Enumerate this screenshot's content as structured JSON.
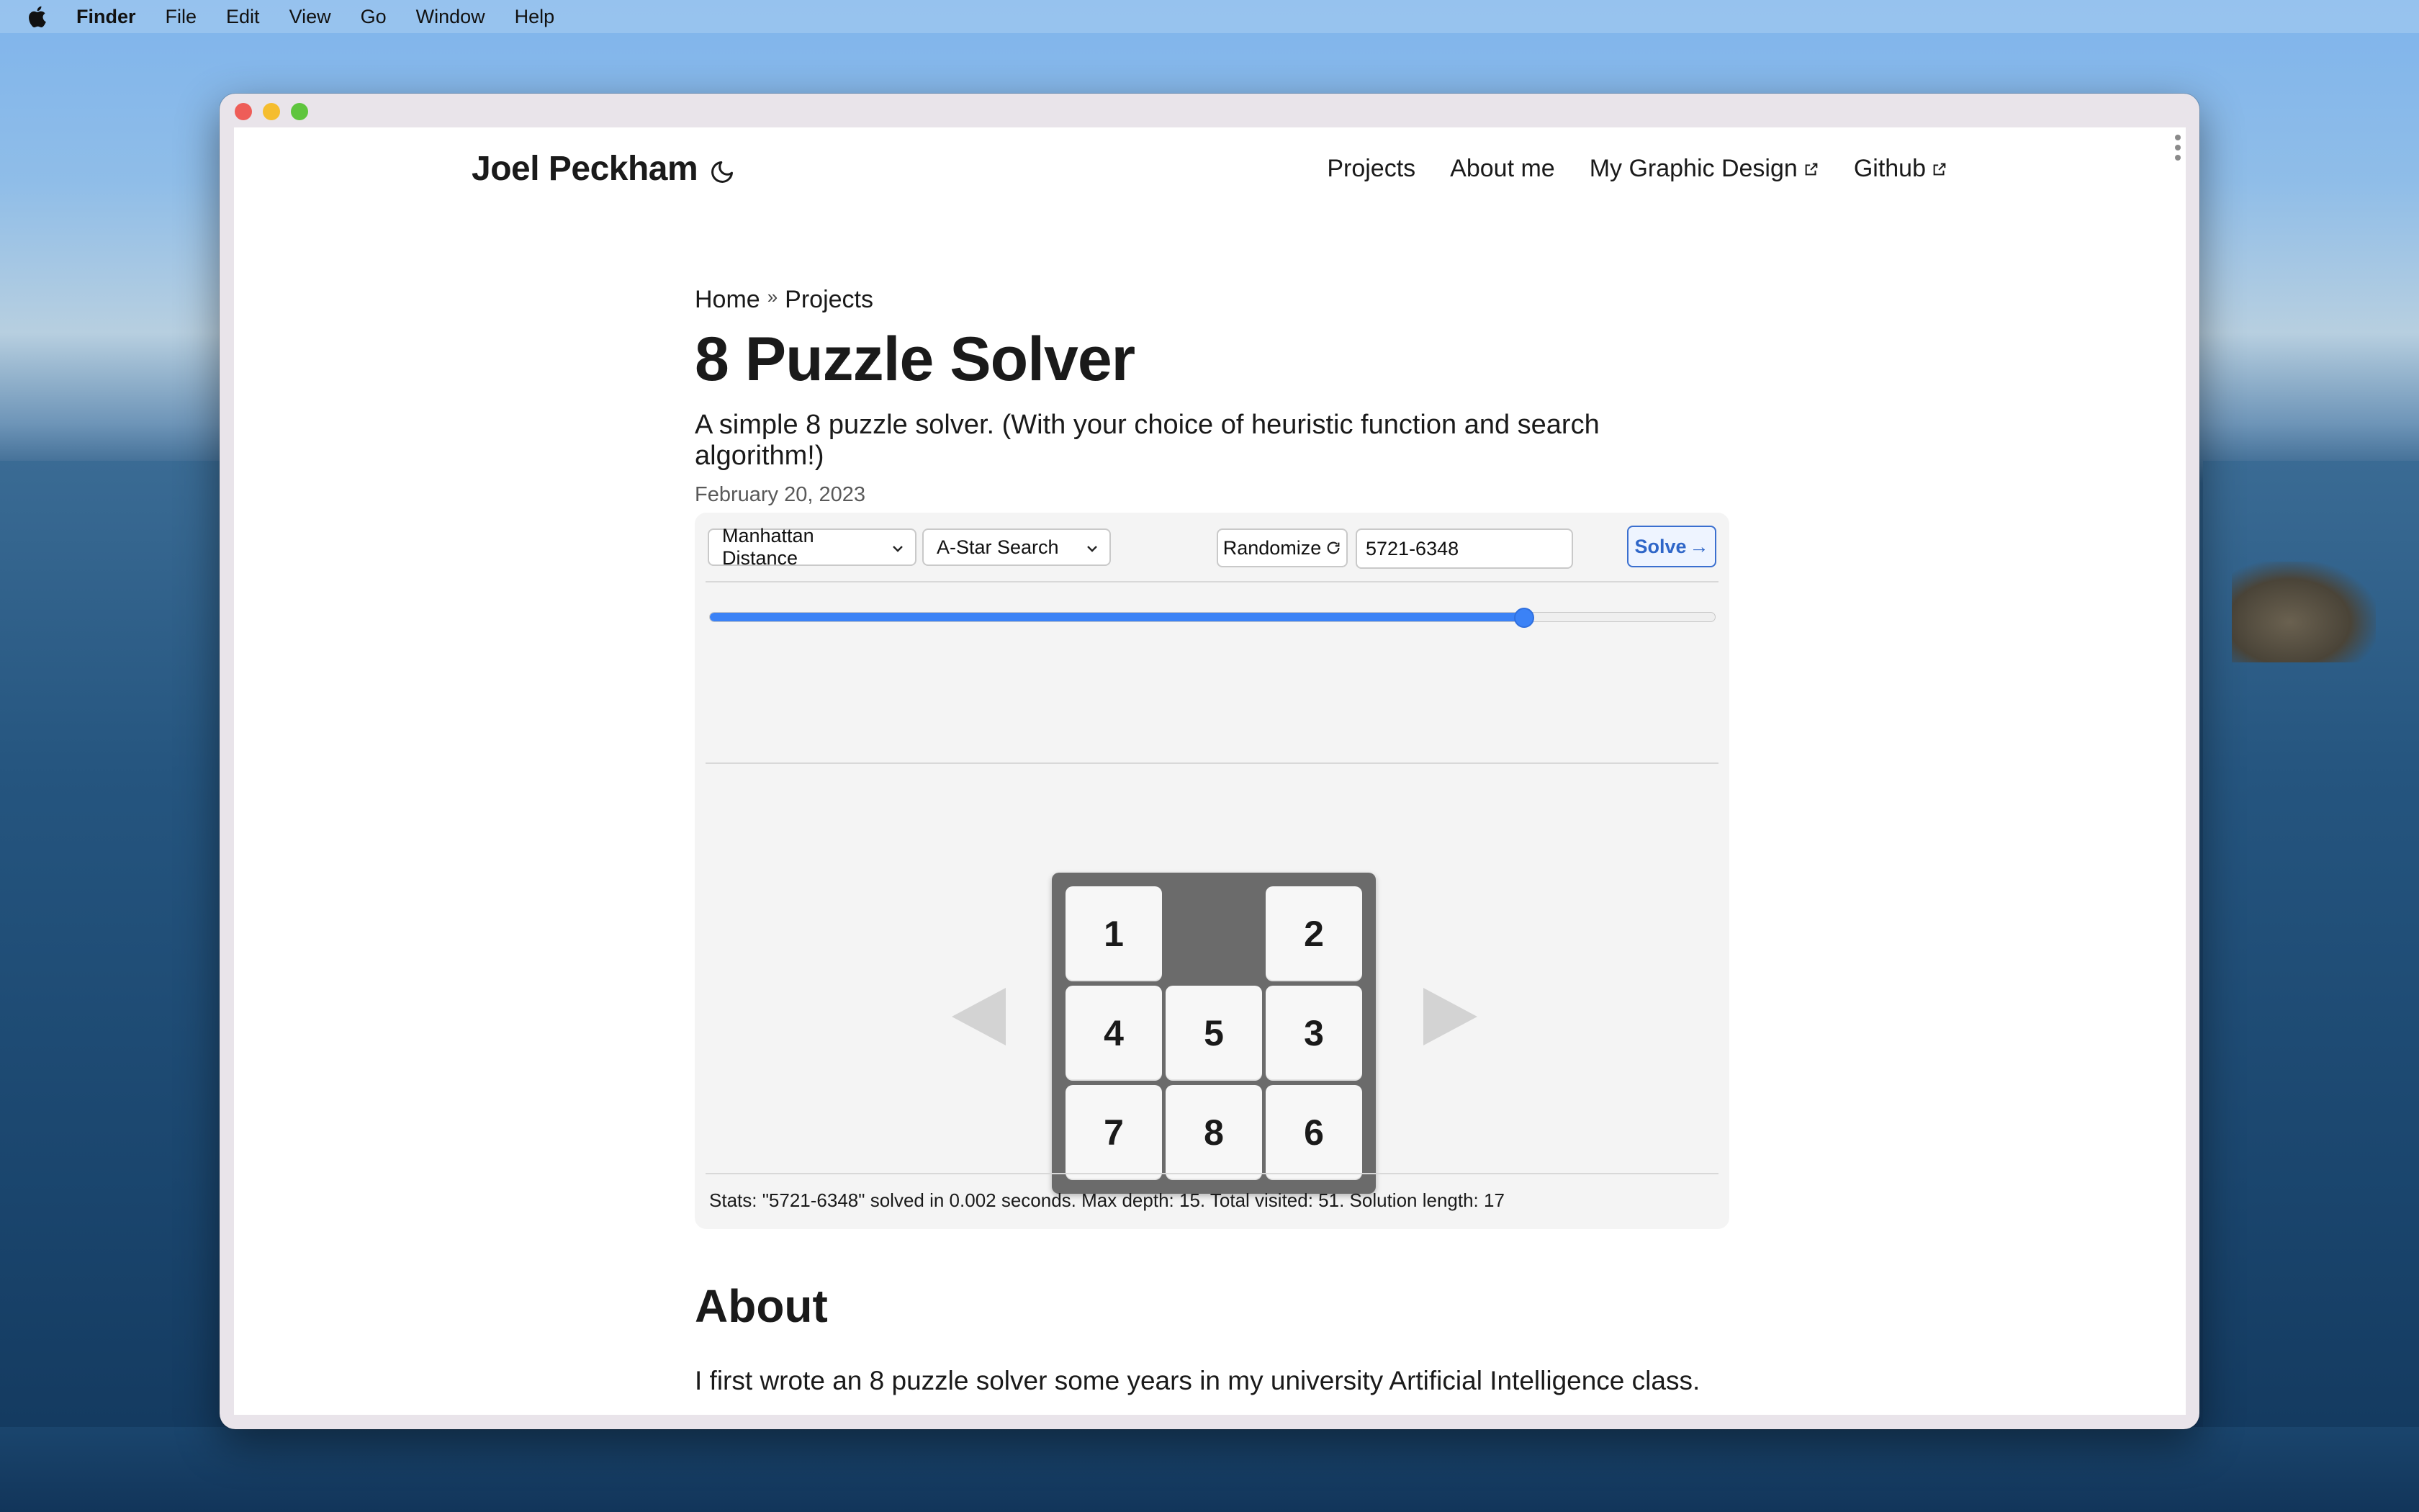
{
  "menubar": {
    "app_name": "Finder",
    "items": [
      "File",
      "Edit",
      "View",
      "Go",
      "Window",
      "Help"
    ]
  },
  "site": {
    "title": "Joel Peckham",
    "nav": [
      {
        "label": "Projects",
        "external": false
      },
      {
        "label": "About me",
        "external": false
      },
      {
        "label": "My Graphic Design",
        "external": true
      },
      {
        "label": "Github",
        "external": true
      }
    ]
  },
  "breadcrumb": {
    "home": "Home",
    "separator": "»",
    "current": "Projects"
  },
  "article": {
    "title": "8 Puzzle Solver",
    "description": "A simple 8 puzzle solver. (With your choice of heuristic function and search algorithm!)",
    "date": "February 20, 2023"
  },
  "solver": {
    "heuristic_select": "Manhattan Distance",
    "algorithm_select": "A-Star Search",
    "randomize_label": "Randomize",
    "seed_value": "5721-6348",
    "solve_label": "Solve",
    "solve_arrow": "→",
    "step_progress": 0.81,
    "board": [
      "1",
      "",
      "2",
      "4",
      "5",
      "3",
      "7",
      "8",
      "6"
    ],
    "stats_text": "Stats: \"5721-6348\" solved in 0.002 seconds. Max depth: 15. Total visited: 51. Solution length: 17"
  },
  "about": {
    "heading": "About",
    "paragraph": "I first wrote an 8 puzzle solver some years in my university Artificial Intelligence class."
  },
  "colors": {
    "accent": "#3b82f6",
    "board_bg": "#6b6b6b",
    "tile_bg": "#f7f7f7",
    "panel_bg": "#f4f4f4"
  }
}
